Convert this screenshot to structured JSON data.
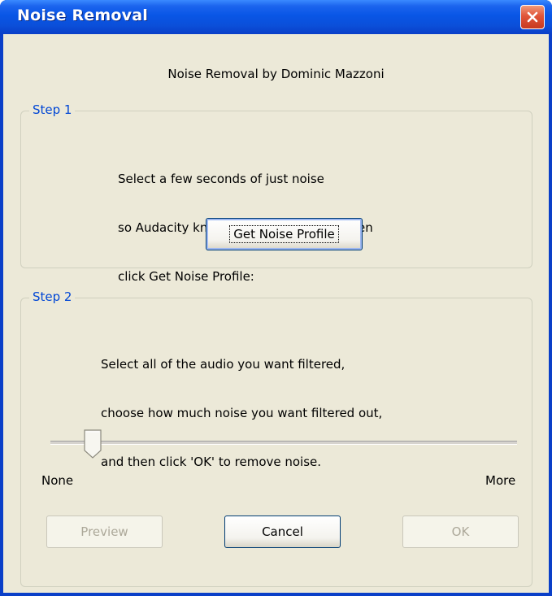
{
  "window": {
    "title": "Noise Removal"
  },
  "dialog": {
    "subtitle": "Noise Removal by Dominic Mazzoni",
    "step1": {
      "legend": "Step 1",
      "lines": [
        "Select a few seconds of just noise",
        "so Audacity knows what to filter out, then",
        "click Get Noise Profile:"
      ],
      "button_label": "Get Noise Profile"
    },
    "step2": {
      "legend": "Step 2",
      "lines": [
        "Select all of the audio you want filtered,",
        "choose how much noise you want filtered out,",
        "and then click 'OK' to remove noise."
      ],
      "slider": {
        "min_label": "None",
        "max_label": "More",
        "value_fraction": 0.09
      }
    },
    "buttons": {
      "preview": "Preview",
      "cancel": "Cancel",
      "ok": "OK"
    }
  },
  "colors": {
    "titlebar": "#0A3FC8",
    "client_bg": "#ECE9D8",
    "legend_text": "#0046D5",
    "close_button": "#E0553A"
  },
  "icons": {
    "close": "close-icon"
  }
}
